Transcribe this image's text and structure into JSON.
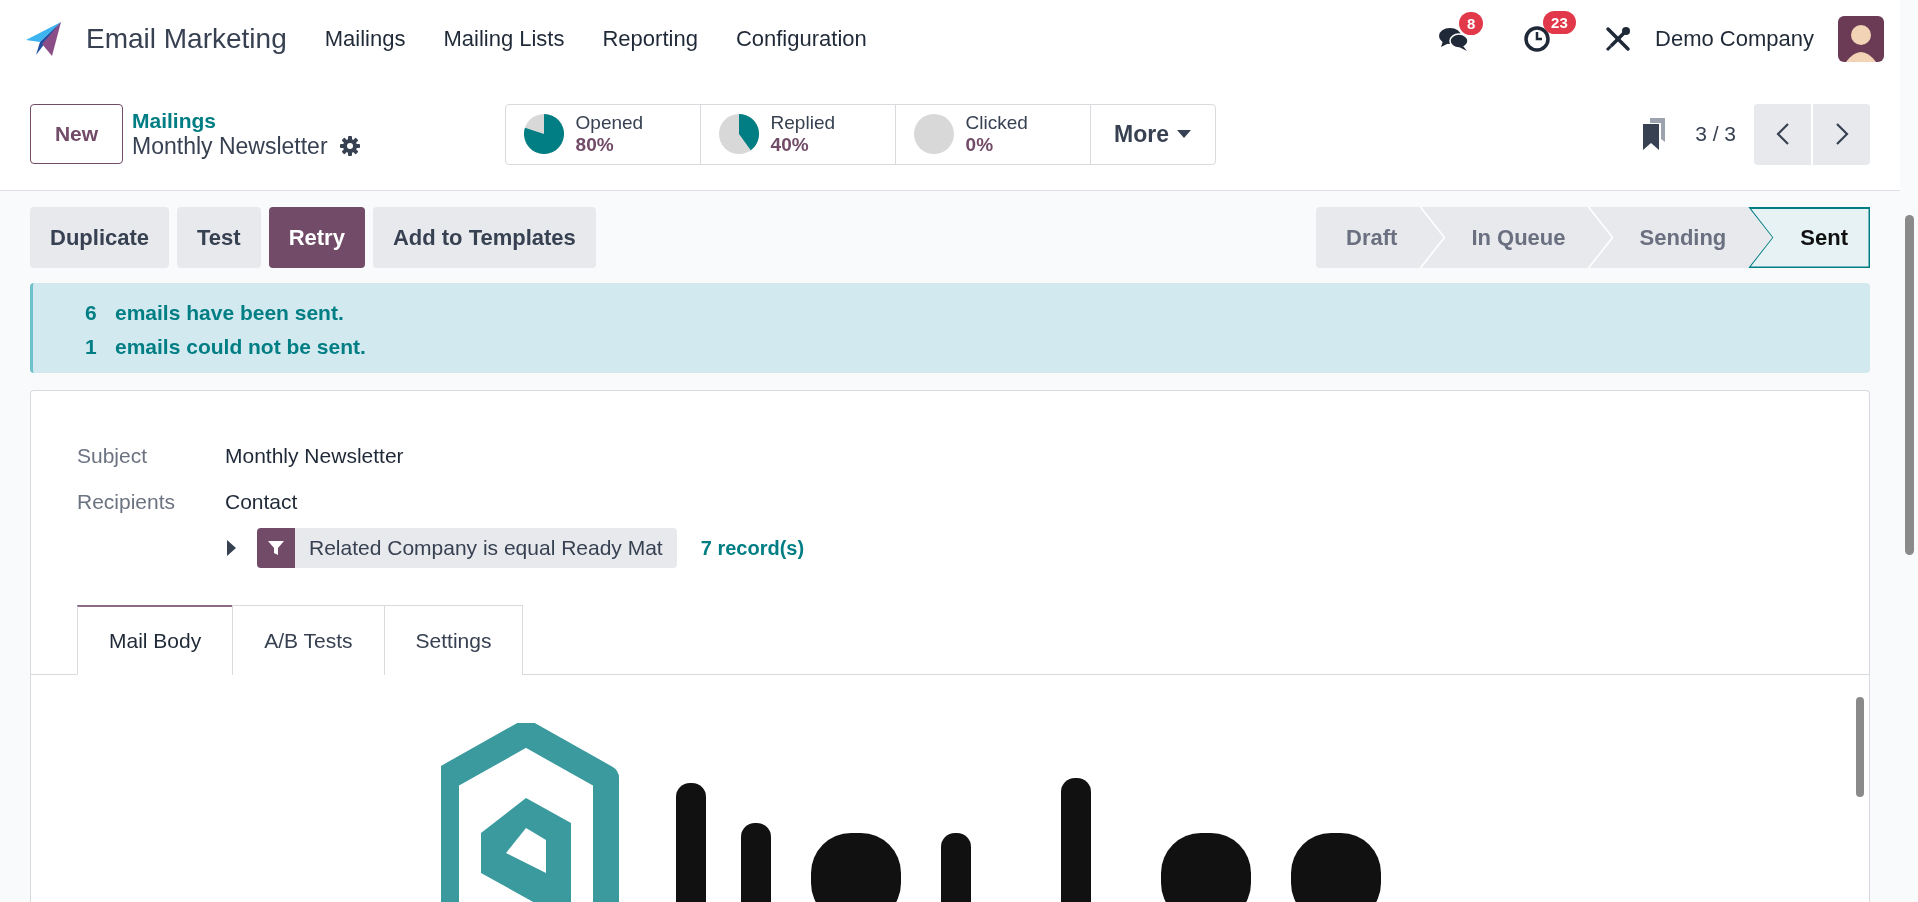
{
  "app": {
    "name": "Email Marketing"
  },
  "menu": [
    {
      "label": "Mailings"
    },
    {
      "label": "Mailing Lists"
    },
    {
      "label": "Reporting"
    },
    {
      "label": "Configuration"
    }
  ],
  "systray": {
    "messages_count": "8",
    "activities_count": "23",
    "company": "Demo Company"
  },
  "control_panel": {
    "new_button": "New",
    "breadcrumb": "Mailings",
    "record_title": "Monthly Newsletter",
    "stats": [
      {
        "label": "Opened",
        "value": "80%"
      },
      {
        "label": "Replied",
        "value": "40%"
      },
      {
        "label": "Clicked",
        "value": "0%"
      }
    ],
    "more": "More",
    "pager": "3 / 3"
  },
  "actions": [
    {
      "label": "Duplicate",
      "primary": false
    },
    {
      "label": "Test",
      "primary": false
    },
    {
      "label": "Retry",
      "primary": true
    },
    {
      "label": "Add to Templates",
      "primary": false
    }
  ],
  "stages": [
    {
      "label": "Draft",
      "selected": false
    },
    {
      "label": "In Queue",
      "selected": false
    },
    {
      "label": "Sending",
      "selected": false
    },
    {
      "label": "Sent",
      "selected": true
    }
  ],
  "alert": {
    "lines": [
      {
        "count": "6",
        "text": "emails have been sent."
      },
      {
        "count": "1",
        "text": "emails could not be sent."
      }
    ]
  },
  "form": {
    "fields": [
      {
        "label": "Subject",
        "value": "Monthly Newsletter"
      },
      {
        "label": "Recipients",
        "value": "Contact"
      }
    ],
    "filter": {
      "text": "Related Company is equal Ready Mat",
      "count": "7 record(s)",
      "expanded": false
    }
  },
  "tabs": [
    {
      "label": "Mail Body",
      "selected": true
    },
    {
      "label": "A/B Tests",
      "selected": false
    },
    {
      "label": "Settings",
      "selected": false
    }
  ]
}
